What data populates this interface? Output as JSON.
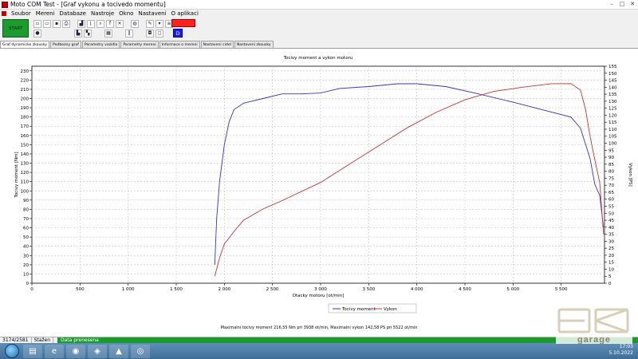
{
  "window": {
    "title": "Moto COM Test - [Graf vykonu a tocivedo momentu]",
    "controls": [
      "–",
      "□",
      "✕"
    ]
  },
  "menu": [
    "Soubor",
    "Mereni",
    "Databaze",
    "Nastroje",
    "Okno",
    "Nastaveni",
    "O aplikaci"
  ],
  "toolbar": {
    "start_label": "START",
    "d_label": "D",
    "row1_icons": [
      "new-file-icon",
      "open-file-icon",
      "save-icon",
      "print-icon",
      "chart-icon",
      "chart-axis-icon",
      "zoom-icon",
      "ff-icon",
      "cross-tools-icon",
      "globe-icon",
      "tools-icon",
      "filter-icon",
      "list-icon"
    ],
    "row2_icons": [
      "record-icon",
      "graph-bars-icon",
      "graph-add-icon",
      "table-icon",
      "pause-icon",
      "settings-icon",
      "window-icon"
    ]
  },
  "tabs": [
    "Graf dynamicke zkousky",
    "Pedbezny graf",
    "Parametry vozidla",
    "Parametry mereni",
    "Informace o mereni",
    "Nastaveni cidel",
    "Nastaveni zkousky"
  ],
  "chart_data": {
    "type": "line",
    "title": "Tocivy moment a vykon motoru",
    "xlabel": "Otacky motoru [ot/min]",
    "ylabel_left": "Tocivy moment [Nm]",
    "ylabel_right": "Vykon [PS]",
    "xlim": [
      0,
      5950
    ],
    "ylim_left": [
      0,
      235
    ],
    "ylim_right": [
      0,
      155
    ],
    "x_ticks": [
      "0",
      "500",
      "1 000",
      "1 500",
      "2 000",
      "2 500",
      "3 000",
      "3 500",
      "4 000",
      "4 500",
      "5 000",
      "5 500"
    ],
    "x_tick_values": [
      0,
      500,
      1000,
      1500,
      2000,
      2500,
      3000,
      3500,
      4000,
      4500,
      5000,
      5500
    ],
    "y_left_ticks": [
      0,
      10,
      20,
      30,
      40,
      50,
      60,
      70,
      80,
      90,
      100,
      110,
      120,
      130,
      140,
      150,
      160,
      170,
      180,
      190,
      200,
      210,
      220,
      230
    ],
    "y_right_ticks": [
      0,
      5,
      10,
      15,
      20,
      25,
      30,
      35,
      40,
      45,
      50,
      55,
      60,
      65,
      70,
      75,
      80,
      85,
      90,
      95,
      100,
      105,
      110,
      115,
      120,
      125,
      130,
      135,
      140,
      145,
      150,
      155
    ],
    "grid": true,
    "legend_position": "bottom-center",
    "series": [
      {
        "name": "Tocivy moment",
        "axis": "left",
        "color": "#3333cc",
        "points": [
          [
            1900,
            20
          ],
          [
            1920,
            70
          ],
          [
            1950,
            110
          ],
          [
            2000,
            150
          ],
          [
            2050,
            175
          ],
          [
            2100,
            188
          ],
          [
            2200,
            195
          ],
          [
            2400,
            200
          ],
          [
            2600,
            205
          ],
          [
            2800,
            205
          ],
          [
            3000,
            206
          ],
          [
            3200,
            211
          ],
          [
            3500,
            213
          ],
          [
            3800,
            216
          ],
          [
            4000,
            216
          ],
          [
            4300,
            213
          ],
          [
            4600,
            206
          ],
          [
            5000,
            196
          ],
          [
            5300,
            188
          ],
          [
            5600,
            180
          ],
          [
            5700,
            168
          ],
          [
            5800,
            135
          ],
          [
            5850,
            107
          ],
          [
            5900,
            95
          ],
          [
            5940,
            60
          ]
        ]
      },
      {
        "name": "Vykon",
        "axis": "right",
        "color": "#cc3333",
        "points": [
          [
            1900,
            5
          ],
          [
            1950,
            18
          ],
          [
            2000,
            28
          ],
          [
            2100,
            37
          ],
          [
            2200,
            45
          ],
          [
            2400,
            53
          ],
          [
            2600,
            59
          ],
          [
            3000,
            72
          ],
          [
            3300,
            85
          ],
          [
            3600,
            98
          ],
          [
            3900,
            111
          ],
          [
            4200,
            122
          ],
          [
            4500,
            131
          ],
          [
            4800,
            137
          ],
          [
            5100,
            140
          ],
          [
            5400,
            142.5
          ],
          [
            5600,
            142.6
          ],
          [
            5700,
            138
          ],
          [
            5750,
            125
          ],
          [
            5800,
            105
          ],
          [
            5850,
            88
          ],
          [
            5900,
            72
          ],
          [
            5940,
            35
          ]
        ]
      }
    ],
    "footer_text": "Maximalni tocivy moment 216,55 Nm pri 3938 ot/min,  Maximalni vykon 142,58 PS pri 5522 ot/min"
  },
  "statusbar": {
    "coords": "3174/2581",
    "state_label": "Stažen",
    "progress_text": "Data prenesena",
    "progress": 1.0
  },
  "taskbar": {
    "apps": [
      "explorer-icon",
      "internet-explorer-icon",
      "firefox-icon",
      "motorbike-app-icon",
      "pdf-icon",
      "chrome-icon"
    ],
    "tray_lang": "EN",
    "tray_time": "17:03",
    "tray_date": "5.10.2022"
  },
  "watermark": {
    "brand": "BK",
    "brand_sub": "garage"
  }
}
